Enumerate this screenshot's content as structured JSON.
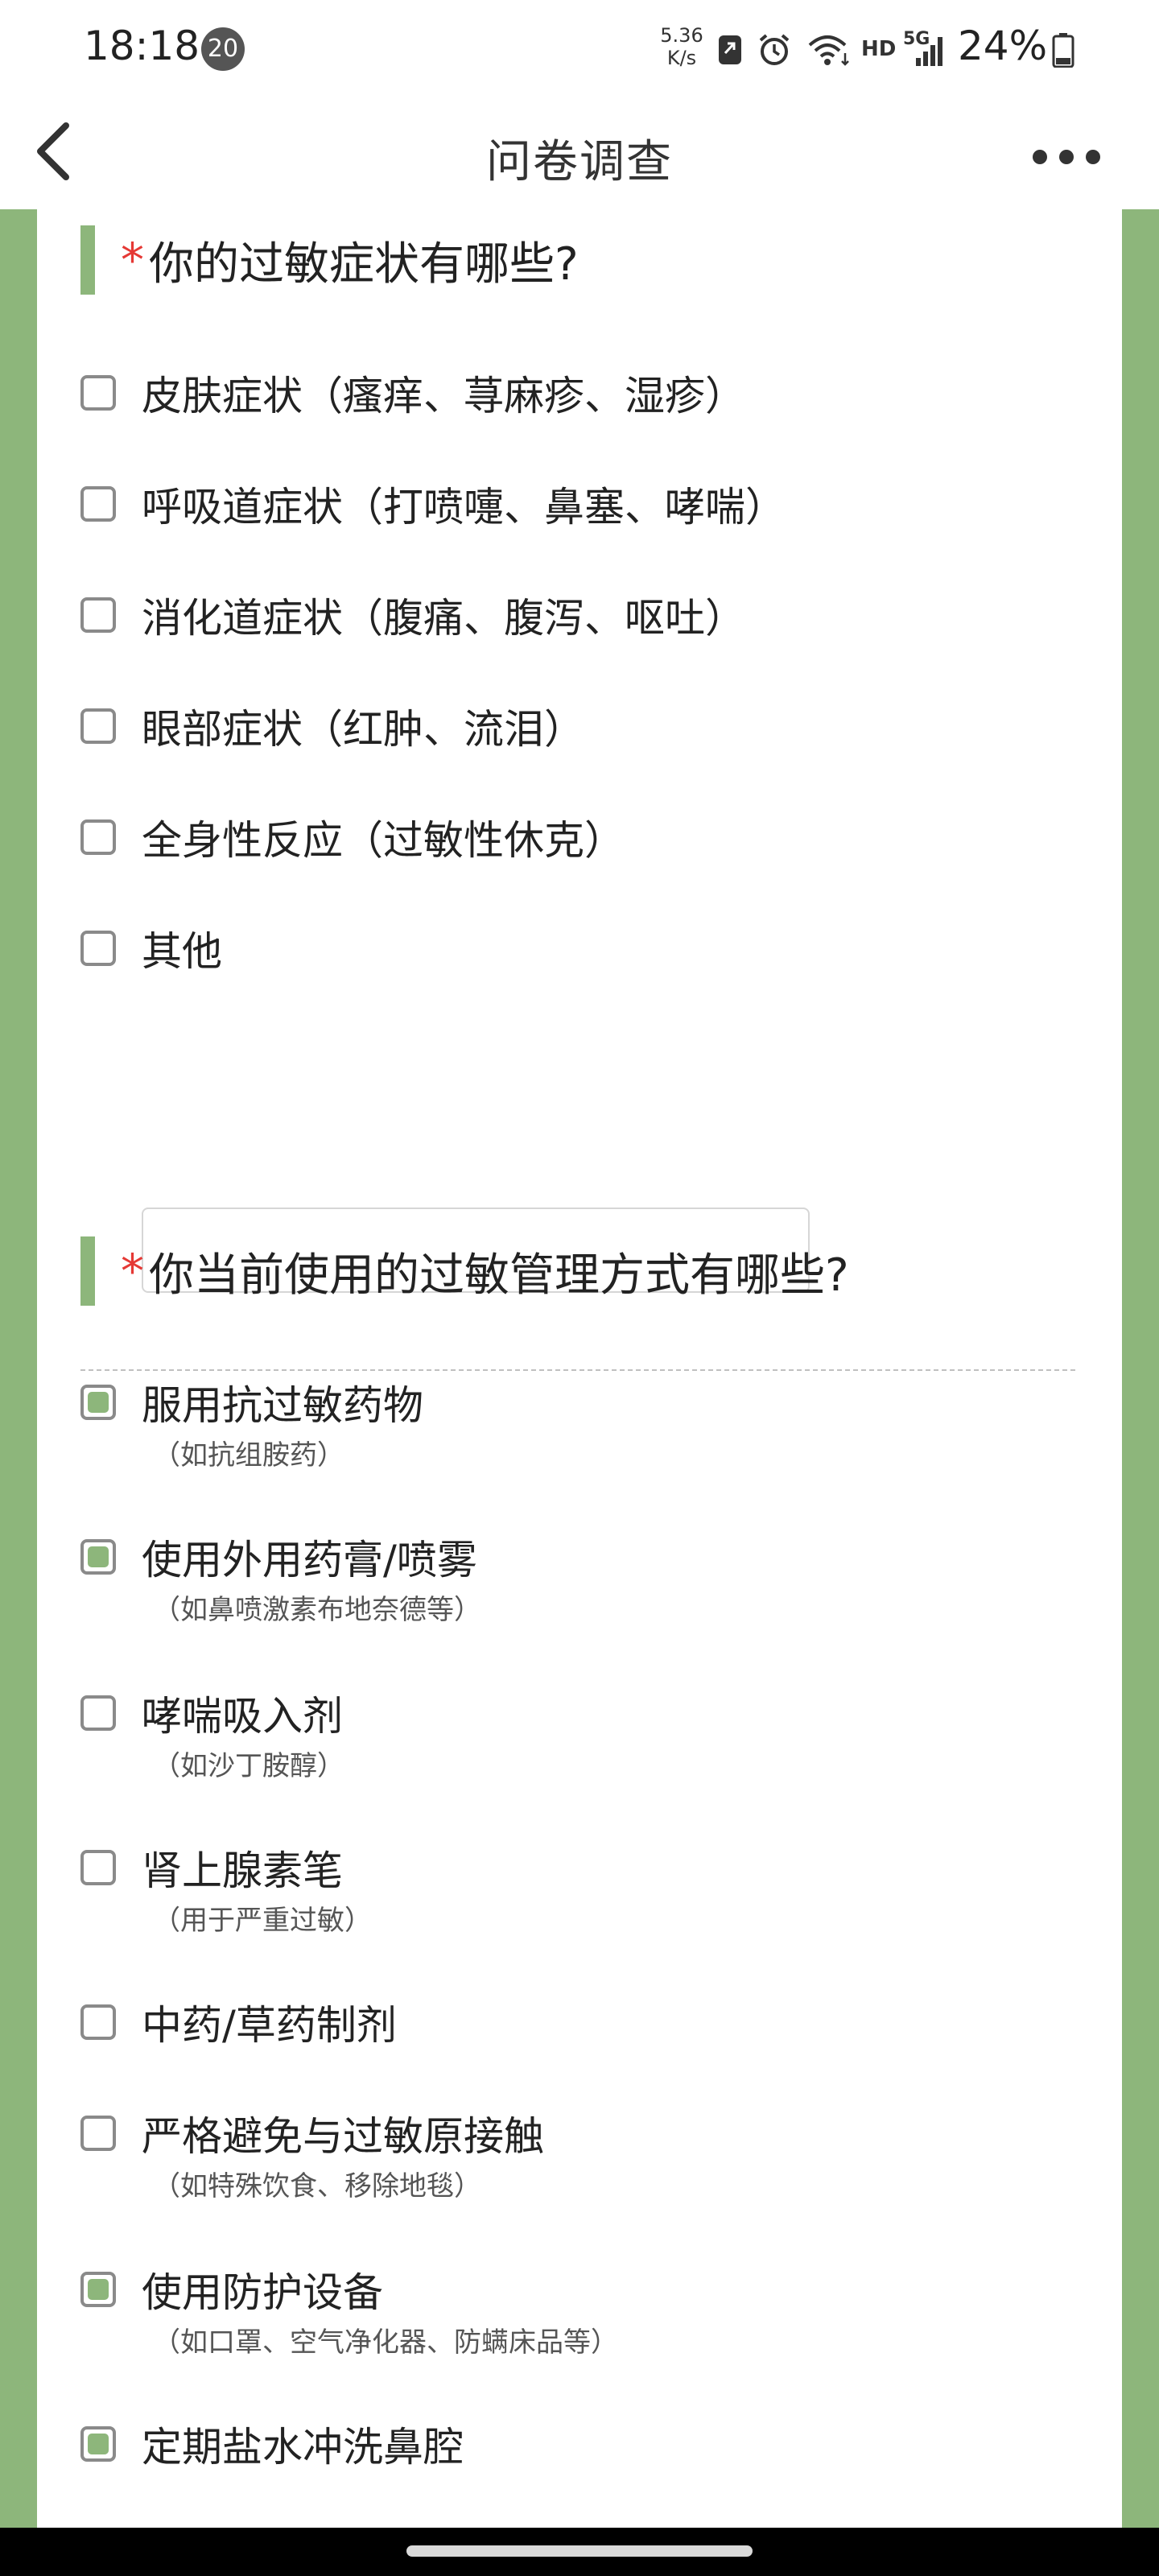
{
  "status_bar": {
    "time": "18:18",
    "notification_count": "20",
    "net_speed_value": "5.36",
    "net_speed_unit": "K/s",
    "hd_label": "HD",
    "network_type": "5G",
    "battery": "24%",
    "icons": [
      "app-notification-icon",
      "alarm-icon",
      "wifi-icon",
      "signal-icon",
      "battery-icon"
    ]
  },
  "header": {
    "title": "问卷调查",
    "back_icon": "back-arrow-icon",
    "more_icon": "more-options-icon"
  },
  "colors": {
    "accent": "#8db67b",
    "required": "#e53935",
    "checkbox_border": "#8a8a8a"
  },
  "questions": [
    {
      "required_mark": "*",
      "title": "你的过敏症状有哪些?",
      "options": [
        {
          "label": "皮肤症状（瘙痒、荨麻疹、湿疹）",
          "checked": false
        },
        {
          "label": "呼吸道症状（打喷嚏、鼻塞、哮喘）",
          "checked": false
        },
        {
          "label": "消化道症状（腹痛、腹泻、呕吐）",
          "checked": false
        },
        {
          "label": "眼部症状（红肿、流泪）",
          "checked": false
        },
        {
          "label": "全身性反应（过敏性休克）",
          "checked": false
        },
        {
          "label": "其他",
          "checked": false,
          "input_value": ""
        }
      ]
    },
    {
      "required_mark": "*",
      "title": "你当前使用的过敏管理方式有哪些?",
      "options": [
        {
          "label": "服用抗过敏药物",
          "sub": "（如抗组胺药）",
          "checked": true
        },
        {
          "label": "使用外用药膏/喷雾",
          "sub": "（如鼻喷激素布地奈德等）",
          "checked": true
        },
        {
          "label": "哮喘吸入剂",
          "sub": "（如沙丁胺醇）",
          "checked": false
        },
        {
          "label": "肾上腺素笔",
          "sub": "（用于严重过敏）",
          "checked": false
        },
        {
          "label": "中药/草药制剂",
          "checked": false
        },
        {
          "label": "严格避免与过敏原接触",
          "sub": "（如特殊饮食、移除地毯）",
          "checked": false
        },
        {
          "label": "使用防护设备",
          "sub": "（如口罩、空气净化器、防螨床品等）",
          "checked": true
        },
        {
          "label": "定期盐水冲洗鼻腔",
          "checked": true
        }
      ]
    }
  ]
}
